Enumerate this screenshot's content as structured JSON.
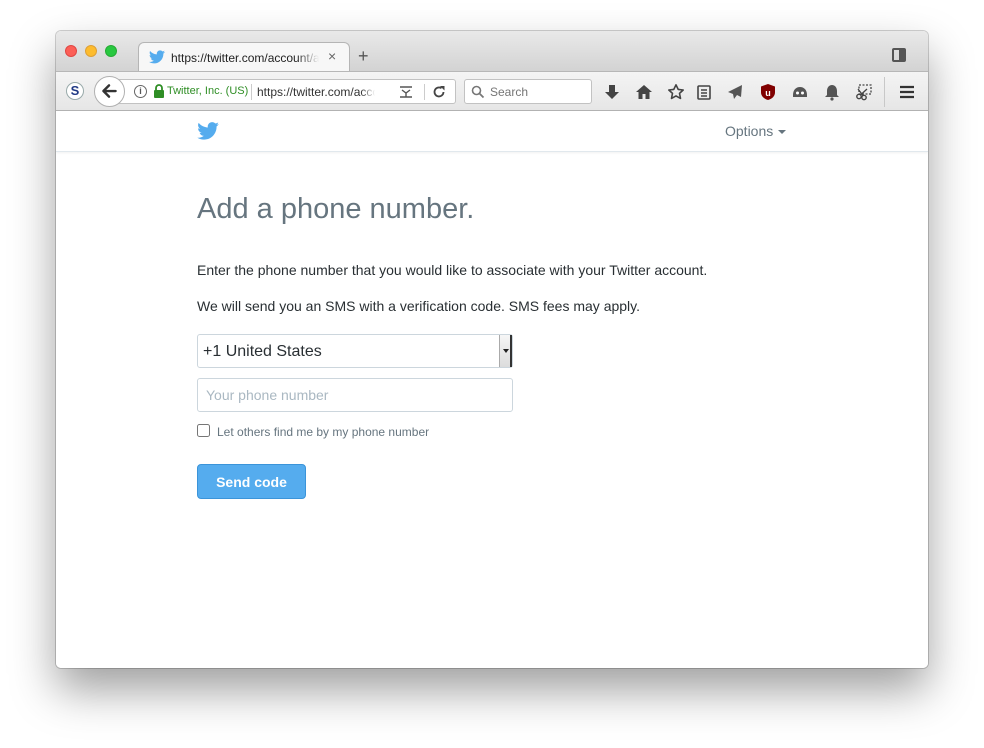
{
  "browser": {
    "tab": {
      "title": "https://twitter.com/account/add"
    },
    "url": {
      "identity": "Twitter, Inc. (US)",
      "text": "https://twitter.com/account/add"
    },
    "search": {
      "placeholder": "Search"
    }
  },
  "header": {
    "options_label": "Options"
  },
  "page": {
    "title": "Add a phone number.",
    "intro": "Enter the phone number that you would like to associate with your Twitter account.",
    "sms_notice": "We will send you an SMS with a verification code. SMS fees may apply.",
    "country_select": {
      "value": "+1 United States"
    },
    "phone_input": {
      "placeholder": "Your phone number",
      "value": ""
    },
    "discoverability": {
      "label": "Let others find me by my phone number",
      "checked": false
    },
    "submit_label": "Send code"
  },
  "colors": {
    "twitter_blue": "#55acee",
    "title_gray": "#66757f",
    "text": "#292f33"
  }
}
